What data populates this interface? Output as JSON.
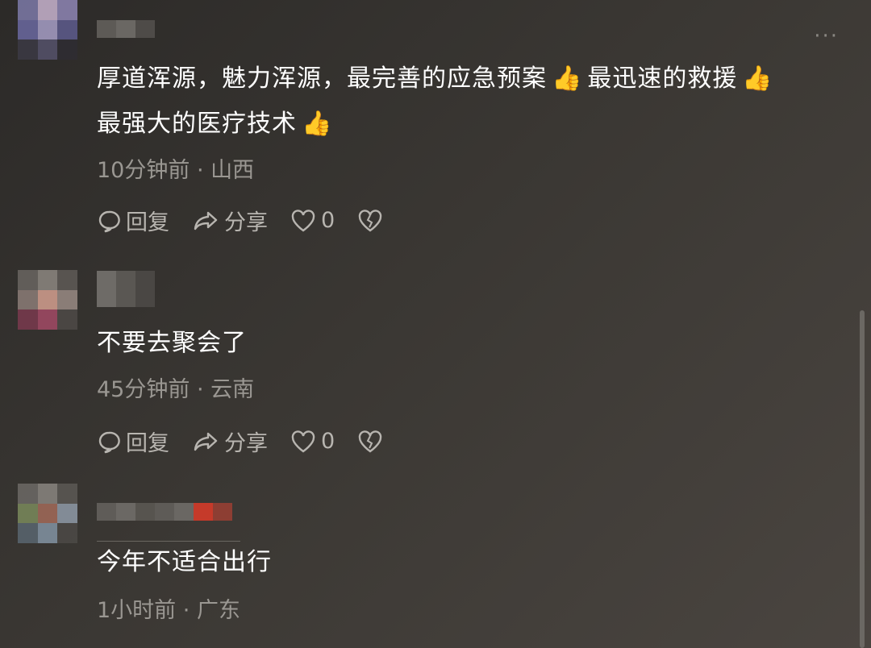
{
  "comments": [
    {
      "text_line1": "厚道浑源，魅力浑源，最完善的应急预案",
      "text_line1b": "最迅速的救援",
      "text_line2": "最强大的医疗技术",
      "time": "10分钟前",
      "location": "山西",
      "reply_label": "回复",
      "share_label": "分享",
      "like_count": "0"
    },
    {
      "text": "不要去聚会了",
      "time": "45分钟前",
      "location": "云南",
      "reply_label": "回复",
      "share_label": "分享",
      "like_count": "0"
    },
    {
      "text": "今年不适合出行",
      "time": "1小时前",
      "location": "广东"
    }
  ],
  "separator": "·",
  "icons": {
    "thumbs_up": "👍",
    "more": "···"
  },
  "colors": {
    "text_primary": "#ffffff",
    "text_meta": "#9a9792",
    "action": "#b8b5b0"
  }
}
